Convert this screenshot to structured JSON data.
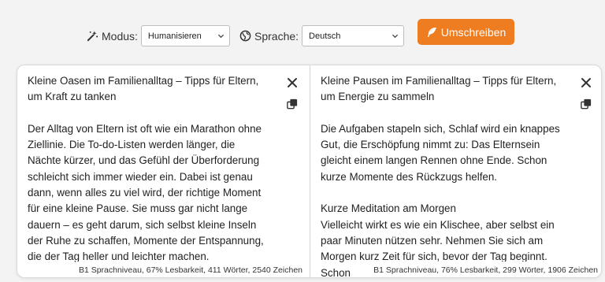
{
  "toolbar": {
    "mode_label": "Modus:",
    "mode_value": "Humanisieren",
    "language_label": "Sprache:",
    "language_value": "Deutsch",
    "rewrite_label": "Umschreiben",
    "accent_color": "#ee7d22"
  },
  "input_pane": {
    "text": "Kleine Oasen im Familienalltag – Tipps für Eltern,\num Kraft zu tanken\n\nDer Alltag von Eltern ist oft wie ein Marathon ohne\nZiellinie. Die To-do-Listen werden länger, die\nNächte kürzer, und das Gefühl der Überforderung\nschleicht sich immer wieder ein. Dabei ist genau\ndann, wenn alles zu viel wird, der richtige Moment\nfür eine kleine Pause. Sie muss gar nicht lange\ndauern – es geht darum, sich selbst kleine Inseln\nder Ruhe zu schaffen, Momente der Entspannung,\ndie der Tag heller und leichter machen.",
    "stats": "B1 Sprachniveau, 67% Lesbarkeit, 411 Wörter, 2540 Zeichen"
  },
  "output_pane": {
    "text": "Kleine Pausen im Familienalltag – Tipps für Eltern,\num Energie zu sammeln\n\nDie Aufgaben stapeln sich, Schlaf wird ein knappes\nGut, die Erschöpfung nimmt zu: Das Elternsein\ngleicht einem langen Rennen ohne Ende. Schon\nkurze Momente des Rückzugs helfen.\n\nKurze Meditation am Morgen\nVielleicht wirkt es wie ein Klischee, aber selbst ein\npaar Minuten nützen sehr. Nehmen Sie sich am\nMorgen kurz Zeit für sich, bevor der Tag beginnt.\nSchon",
    "stats": "B1 Sprachniveau, 76% Lesbarkeit, 299 Wörter, 1906 Zeichen"
  }
}
